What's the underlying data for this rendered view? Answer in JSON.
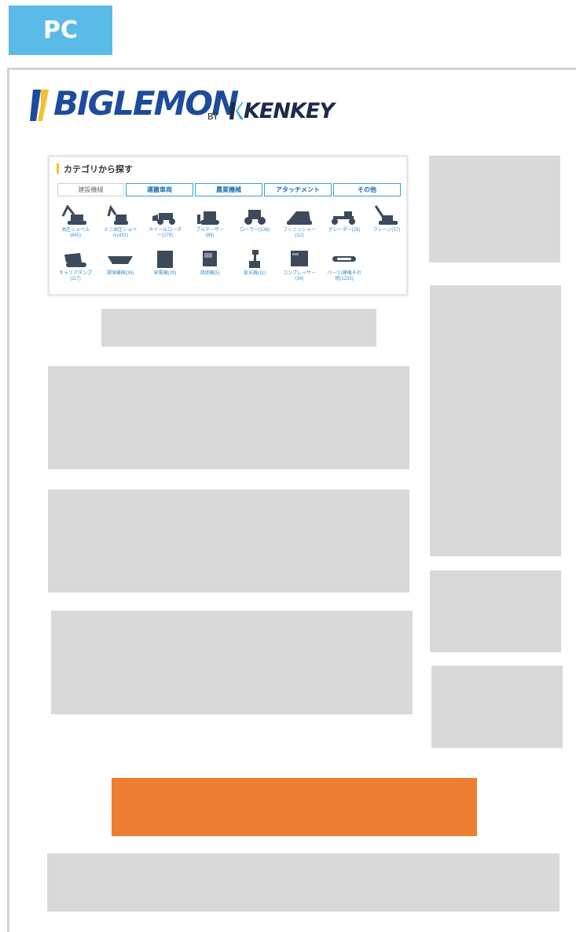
{
  "badge": {
    "label": "PC"
  },
  "logo": {
    "brand": "BIGLEMON",
    "by": "BY",
    "partner": "KENKEY"
  },
  "category_panel": {
    "title": "カテゴリから探す",
    "tabs": [
      {
        "label": "建設機械",
        "active": true
      },
      {
        "label": "運搬車両",
        "active": false
      },
      {
        "label": "農業機械",
        "active": false
      },
      {
        "label": "アタッチメント",
        "active": false
      },
      {
        "label": "その他",
        "active": false
      }
    ],
    "items": [
      {
        "label1": "油圧ショベル",
        "label2": "(665)",
        "icon": "excavator-icon"
      },
      {
        "label1": "ミニ油圧ショベ",
        "label2": "ル(431)",
        "icon": "mini-excavator-icon"
      },
      {
        "label1": "ホイールローダ",
        "label2": "ー(279)",
        "icon": "wheel-loader-icon"
      },
      {
        "label1": "ブルドーザー",
        "label2": "(88)",
        "icon": "bulldozer-icon"
      },
      {
        "label1": "ローラー(136)",
        "label2": "",
        "icon": "roller-icon"
      },
      {
        "label1": "フィニッシャー",
        "label2": "(12)",
        "icon": "finisher-icon"
      },
      {
        "label1": "グレーダー(29)",
        "label2": "",
        "icon": "grader-icon"
      },
      {
        "label1": "クレーン(37)",
        "label2": "",
        "icon": "crane-icon"
      },
      {
        "label1": "キャリアダンプ",
        "label2": "(117)",
        "icon": "carrier-dump-icon"
      },
      {
        "label1": "環境機械(35)",
        "label2": "",
        "icon": "environment-machine-icon"
      },
      {
        "label1": "発電機(29)",
        "label2": "",
        "icon": "generator-icon"
      },
      {
        "label1": "溶接機(5)",
        "label2": "",
        "icon": "welder-icon"
      },
      {
        "label1": "投光器(11)",
        "label2": "",
        "icon": "floodlight-icon"
      },
      {
        "label1": "コンプレッサー",
        "label2": "(16)",
        "icon": "compressor-icon"
      },
      {
        "label1": "パーツ/建機その",
        "label2": "他(1233)",
        "icon": "parts-icon"
      }
    ]
  },
  "colors": {
    "badge": "#5bbbe8",
    "placeholder": "#d9d9d9",
    "cta": "#ed7d31",
    "brand": "#1e4b9b",
    "accent_yellow": "#f2c12e"
  }
}
